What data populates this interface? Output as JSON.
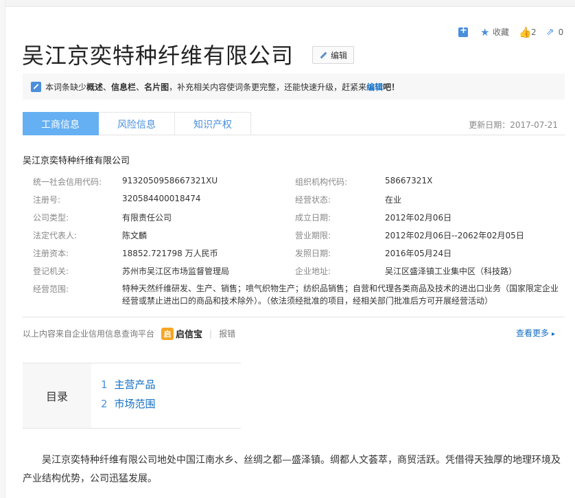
{
  "toolbar": {
    "collect_label": "收藏",
    "like_count": "2",
    "share_count": "0"
  },
  "page": {
    "title": "吴江京奕特种纤维有限公司",
    "edit_label": "编辑"
  },
  "notice": {
    "prefix": "本词条缺少",
    "item1": "概述",
    "sep1": "、",
    "item2": "信息栏",
    "sep2": "、",
    "item3": "名片图",
    "middle": "，补充相关内容使词条更完整，还能快速升级，赶紧来",
    "link": "编辑",
    "suffix": "吧！"
  },
  "tabs": [
    {
      "label": "工商信息"
    },
    {
      "label": "风险信息"
    },
    {
      "label": "知识产权"
    }
  ],
  "update_date": "更新日期：2017-07-21",
  "company_name": "吴江京奕特种纤维有限公司",
  "info": {
    "rows": [
      {
        "label1": "统一社会信用代码:",
        "value1": "9132050958667321XU",
        "label2": "组织机构代码:",
        "value2": "58667321X"
      },
      {
        "label1": "注册号:",
        "value1": "320584400018474",
        "label2": "经营状态:",
        "value2": "在业"
      },
      {
        "label1": "公司类型:",
        "value1": "有限责任公司",
        "label2": "成立日期:",
        "value2": "2012年02月06日"
      },
      {
        "label1": "法定代表人:",
        "value1": "陈文麟",
        "label2": "营业期限:",
        "value2": "2012年02月06日--2062年02月05日"
      },
      {
        "label1": "注册资本:",
        "value1": "18852.721798 万人民币",
        "label2": "发照日期:",
        "value2": "2016年05月24日"
      },
      {
        "label1": "登记机关:",
        "value1": "苏州市吴江区市场监督管理局",
        "label2": "企业地址:",
        "value2": "吴江区盛泽镇工业集中区（科技路）"
      }
    ],
    "scope_label": "经营范围:",
    "scope_value": "特种天然纤维研发、生产、销售；喷气织物生产；纺织品销售；自营和代理各类商品及技术的进出口业务（国家限定企业经营或禁止进出口的商品和技术除外）。（依法须经批准的项目，经相关部门批准后方可开展经营活动）"
  },
  "source": {
    "text": "以上内容来自企业信用信息查询平台",
    "logo_char": "启",
    "logo_text": "启信宝",
    "bar": "|",
    "report": "报错",
    "more": "查看更多",
    "more_arrow": "▸"
  },
  "toc": {
    "label": "目录",
    "items": [
      {
        "num": "1",
        "label": "主营产品"
      },
      {
        "num": "2",
        "label": "市场范围"
      }
    ]
  },
  "paragraph": "吴江京奕特种纤维有限公司地处中国江南水乡、丝绸之都—盛泽镇。绸都人文荟萃，商贸活跃。凭借得天独厚的地理环境及产业结构优势，公司迅猛发展。"
}
